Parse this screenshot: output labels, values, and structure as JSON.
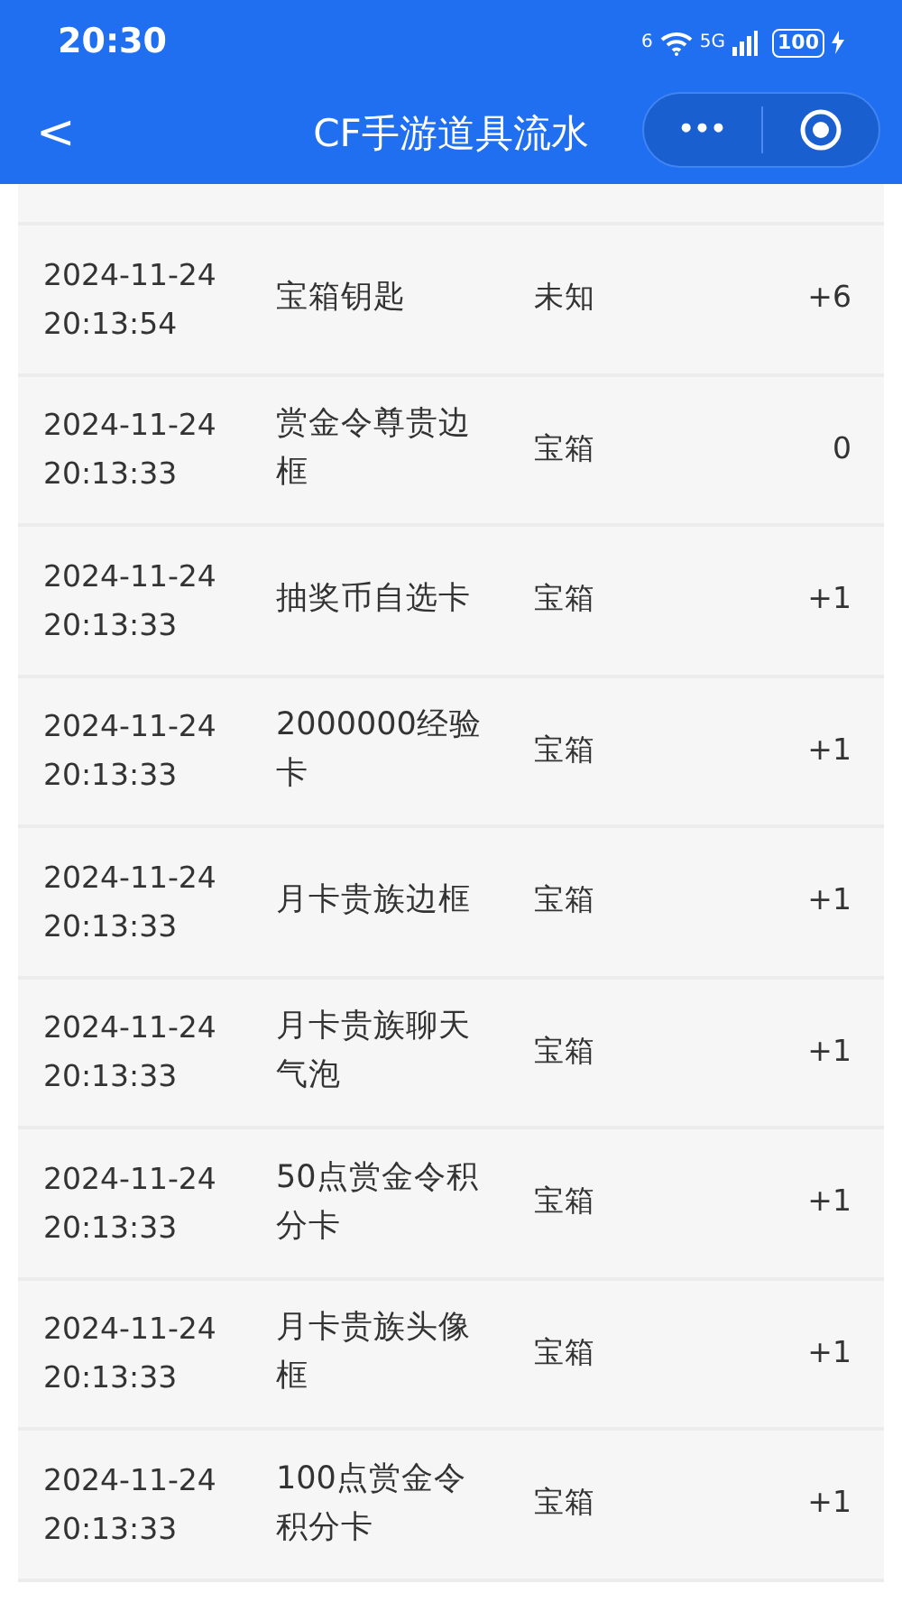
{
  "status_bar": {
    "time": "20:30",
    "wifi_badge": "6",
    "network": "5G",
    "battery": "100"
  },
  "nav": {
    "back": "<",
    "title": "CF手游道具流水",
    "more": "•••"
  },
  "rows": [
    {
      "date": "2024-11-24",
      "time": "20:13:54",
      "item": "宝箱钥匙",
      "type": "未知",
      "count": "+6"
    },
    {
      "date": "2024-11-24",
      "time": "20:13:33",
      "item": "赏金令尊贵边框",
      "type": "宝箱",
      "count": "0"
    },
    {
      "date": "2024-11-24",
      "time": "20:13:33",
      "item": "抽奖币自选卡",
      "type": "宝箱",
      "count": "+1"
    },
    {
      "date": "2024-11-24",
      "time": "20:13:33",
      "item": "2000000经验卡",
      "type": "宝箱",
      "count": "+1"
    },
    {
      "date": "2024-11-24",
      "time": "20:13:33",
      "item": "月卡贵族边框",
      "type": "宝箱",
      "count": "+1"
    },
    {
      "date": "2024-11-24",
      "time": "20:13:33",
      "item": "月卡贵族聊天气泡",
      "type": "宝箱",
      "count": "+1"
    },
    {
      "date": "2024-11-24",
      "time": "20:13:33",
      "item": "50点赏金令积分卡",
      "type": "宝箱",
      "count": "+1"
    },
    {
      "date": "2024-11-24",
      "time": "20:13:33",
      "item": "月卡贵族头像框",
      "type": "宝箱",
      "count": "+1"
    },
    {
      "date": "2024-11-24",
      "time": "20:13:33",
      "item": "100点赏金令积分卡",
      "type": "宝箱",
      "count": "+1"
    }
  ]
}
